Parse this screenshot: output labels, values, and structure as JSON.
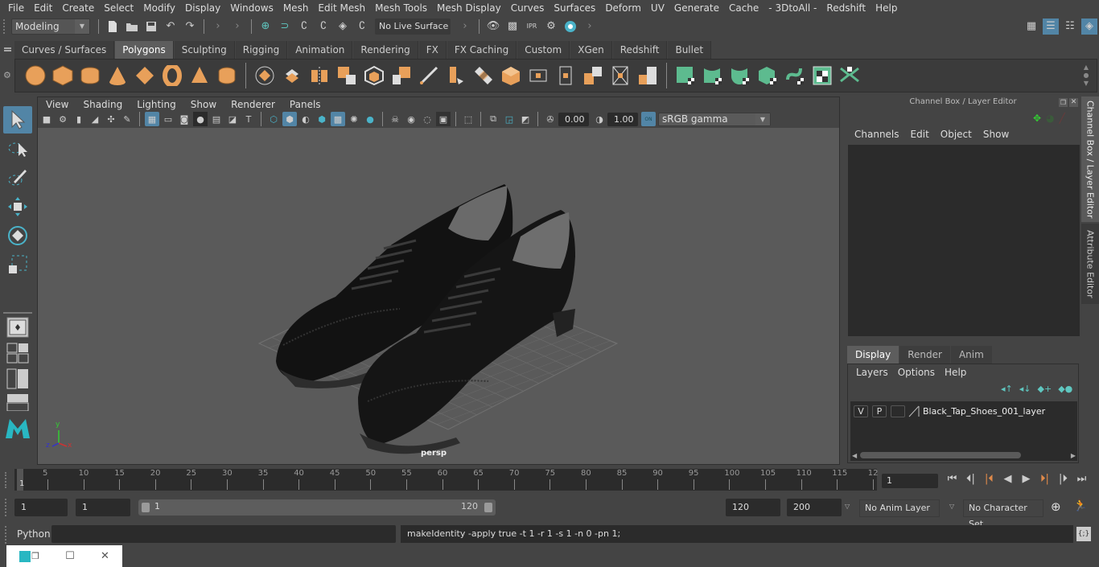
{
  "menubar": {
    "items": [
      "File",
      "Edit",
      "Create",
      "Select",
      "Modify",
      "Display",
      "Windows",
      "Mesh",
      "Edit Mesh",
      "Mesh Tools",
      "Mesh Display",
      "Curves",
      "Surfaces",
      "Deform",
      "UV",
      "Generate",
      "Cache",
      "- 3DtoAll -",
      "Redshift",
      "Help"
    ]
  },
  "statusline": {
    "workspace": "Modeling",
    "live_surface": "No Live Surface"
  },
  "shelf": {
    "tabs": [
      "Curves / Surfaces",
      "Polygons",
      "Sculpting",
      "Rigging",
      "Animation",
      "Rendering",
      "FX",
      "FX Caching",
      "Custom",
      "XGen",
      "Redshift",
      "Bullet"
    ],
    "active_tab": "Polygons",
    "accent_color": "#e8a05a",
    "uv_accent_color": "#5dbb8f"
  },
  "viewport": {
    "menu": [
      "View",
      "Shading",
      "Lighting",
      "Show",
      "Renderer",
      "Panels"
    ],
    "exposure": "0.00",
    "gamma": "1.00",
    "color_mgmt_on": "ON",
    "colorspace": "sRGB gamma",
    "camera_label": "persp",
    "axis": {
      "x": "x",
      "y": "y",
      "z": "z"
    }
  },
  "channel_box": {
    "title": "Channel Box / Layer Editor",
    "menu": [
      "Channels",
      "Edit",
      "Object",
      "Show"
    ]
  },
  "layer_editor": {
    "tabs": [
      "Display",
      "Render",
      "Anim"
    ],
    "active_tab": "Display",
    "menu": [
      "Layers",
      "Options",
      "Help"
    ],
    "layers": [
      {
        "v": "V",
        "p": "P",
        "name": "Black_Tap_Shoes_001_layer"
      }
    ]
  },
  "side_tabs": [
    "Channel Box / Layer Editor",
    "Attribute Editor"
  ],
  "timeline": {
    "ticks": [
      "5",
      "10",
      "15",
      "20",
      "25",
      "30",
      "35",
      "40",
      "45",
      "50",
      "55",
      "60",
      "65",
      "70",
      "75",
      "80",
      "85",
      "90",
      "95",
      "100",
      "105",
      "110",
      "115",
      "12"
    ],
    "start_marker": "1",
    "current_frame": "1"
  },
  "range": {
    "start": "1",
    "playback_start": "1",
    "slider_min": "1",
    "slider_max": "120",
    "playback_end": "120",
    "end": "200",
    "anim_layer": "No Anim Layer",
    "character_set": "No Character Set"
  },
  "cmdline": {
    "label": "Python",
    "input": "",
    "result": "makeIdentity -apply true -t 1 -r 1 -s 1 -n 0 -pn 1;"
  }
}
